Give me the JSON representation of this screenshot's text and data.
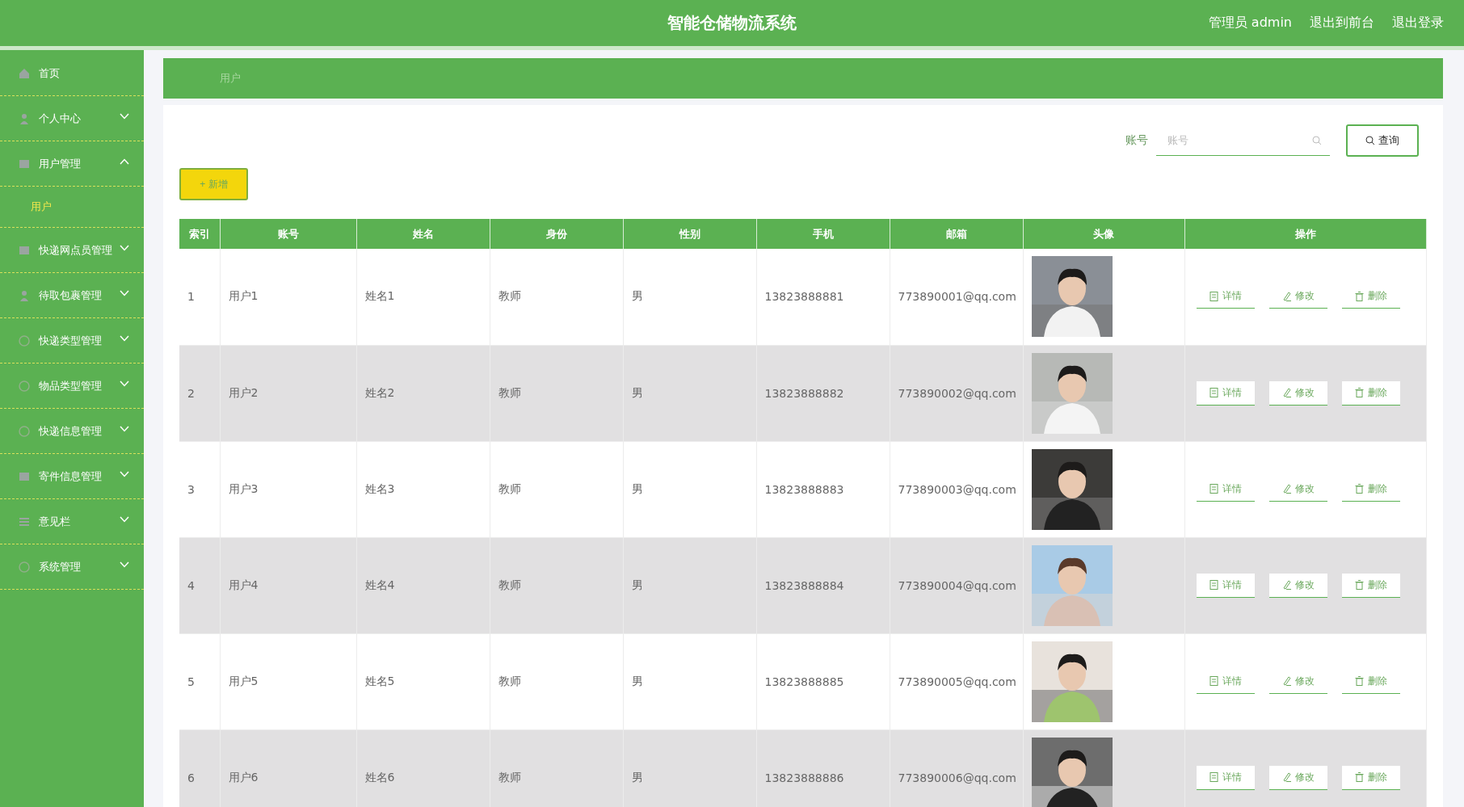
{
  "header": {
    "title": "智能仓储物流系统",
    "links": [
      "管理员 admin",
      "退出到前台",
      "退出登录"
    ]
  },
  "sidebar": {
    "items": [
      {
        "label": "首页"
      },
      {
        "label": "个人中心",
        "expanded": false
      },
      {
        "label": "用户管理",
        "expanded": true,
        "children": [
          {
            "label": "用户",
            "selected": true
          }
        ]
      },
      {
        "label": "快递网点员管理",
        "expanded": false
      },
      {
        "label": "待取包裹管理",
        "expanded": false
      },
      {
        "label": "快递类型管理",
        "expanded": false
      },
      {
        "label": "物品类型管理",
        "expanded": false
      },
      {
        "label": "快递信息管理",
        "expanded": false
      },
      {
        "label": "寄件信息管理",
        "expanded": false
      },
      {
        "label": "意见栏",
        "expanded": false
      },
      {
        "label": "系统管理",
        "expanded": false
      }
    ]
  },
  "breadcrumb": "用户",
  "search": {
    "label": "账号",
    "placeholder": "账号",
    "button": "查询"
  },
  "add_button": "+ 新增",
  "table": {
    "columns": [
      "索引",
      "账号",
      "姓名",
      "身份",
      "性别",
      "手机",
      "邮箱",
      "头像",
      "操作"
    ],
    "rows": [
      {
        "cells": [
          "1",
          "用户1",
          "姓名1",
          "教师",
          "男",
          "13823888881",
          "773890001@qq.com"
        ],
        "actions": [
          "详情",
          "修改",
          "删除"
        ]
      },
      {
        "cells": [
          "2",
          "用户2",
          "姓名2",
          "教师",
          "男",
          "13823888882",
          "773890002@qq.com"
        ],
        "actions": [
          "详情",
          "修改",
          "删除"
        ]
      },
      {
        "cells": [
          "3",
          "用户3",
          "姓名3",
          "教师",
          "男",
          "13823888883",
          "773890003@qq.com"
        ],
        "actions": [
          "详情",
          "修改",
          "删除"
        ]
      },
      {
        "cells": [
          "4",
          "用户4",
          "姓名4",
          "教师",
          "男",
          "13823888884",
          "773890004@qq.com"
        ],
        "actions": [
          "详情",
          "修改",
          "删除"
        ]
      },
      {
        "cells": [
          "5",
          "用户5",
          "姓名5",
          "教师",
          "男",
          "13823888885",
          "773890005@qq.com"
        ],
        "actions": [
          "详情",
          "修改",
          "删除"
        ]
      },
      {
        "cells": [
          "6",
          "用户6",
          "姓名6",
          "教师",
          "男",
          "13823888886",
          "773890006@qq.com"
        ],
        "actions": [
          "详情",
          "修改",
          "删除"
        ]
      }
    ]
  }
}
